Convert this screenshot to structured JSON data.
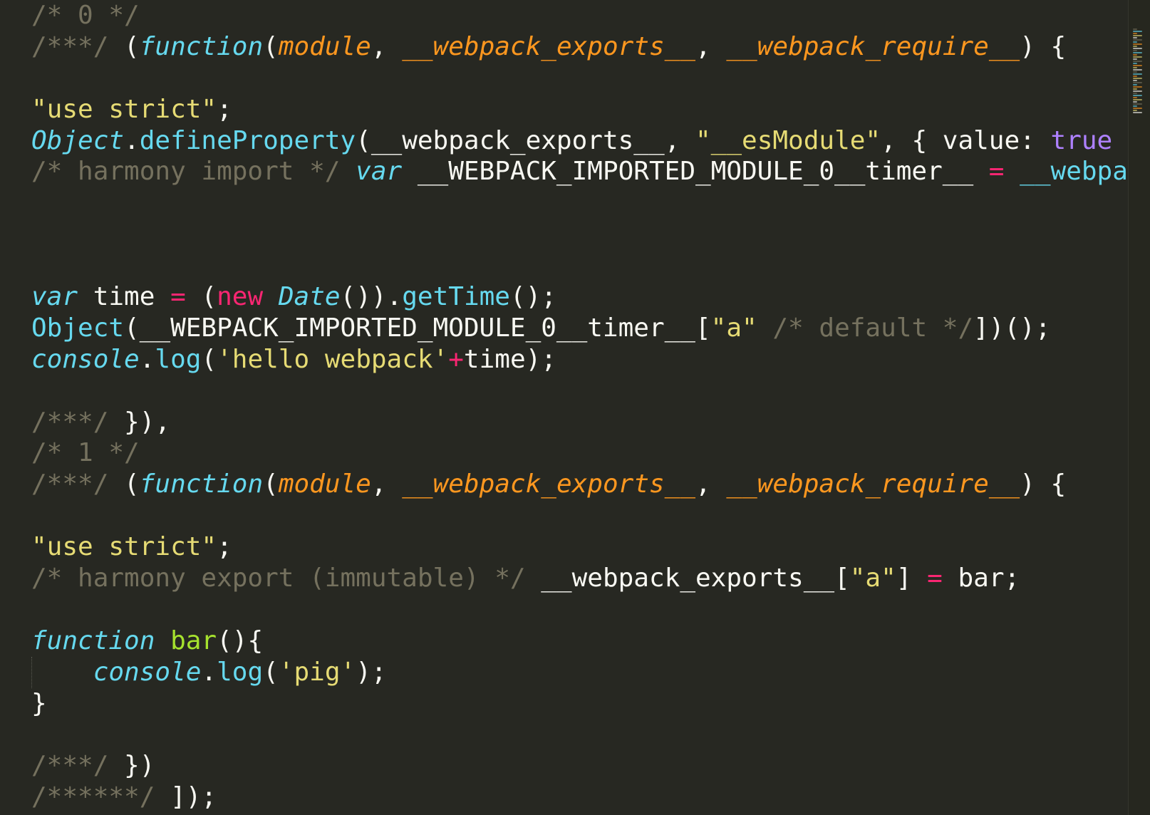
{
  "editor": {
    "theme_colors": {
      "background": "#272822",
      "foreground": "#f8f8f2",
      "comment": "#75715e",
      "string": "#e6db74",
      "keyword": "#66d9ef",
      "storage_pink": "#f92672",
      "parameter": "#fd971f",
      "constant": "#ae81ff",
      "function_name": "#a6e22e"
    },
    "lines": [
      [
        {
          "t": "/* 0 */",
          "c": "comment"
        }
      ],
      [
        {
          "t": "/***/ ",
          "c": "comment"
        },
        {
          "t": "(",
          "c": "plain"
        },
        {
          "t": "function",
          "c": "keyword-italic"
        },
        {
          "t": "(",
          "c": "plain"
        },
        {
          "t": "module",
          "c": "param"
        },
        {
          "t": ", ",
          "c": "plain"
        },
        {
          "t": "__webpack_exports__",
          "c": "param"
        },
        {
          "t": ", ",
          "c": "plain"
        },
        {
          "t": "__webpack_require__",
          "c": "param"
        },
        {
          "t": ") {",
          "c": "plain"
        }
      ],
      [],
      [
        {
          "t": "\"use strict\"",
          "c": "string"
        },
        {
          "t": ";",
          "c": "plain"
        }
      ],
      [
        {
          "t": "Object",
          "c": "keyword-italic"
        },
        {
          "t": ".",
          "c": "plain"
        },
        {
          "t": "defineProperty",
          "c": "keyword"
        },
        {
          "t": "(__webpack_exports__, ",
          "c": "plain"
        },
        {
          "t": "\"__esModule\"",
          "c": "string"
        },
        {
          "t": ", { value: ",
          "c": "plain"
        },
        {
          "t": "true",
          "c": "constant"
        },
        {
          "t": " }",
          "c": "plain"
        }
      ],
      [
        {
          "t": "/* harmony import */ ",
          "c": "comment"
        },
        {
          "t": "var",
          "c": "keyword-italic"
        },
        {
          "t": " __WEBPACK_IMPORTED_MODULE_0__timer__ ",
          "c": "plain"
        },
        {
          "t": "=",
          "c": "pink"
        },
        {
          "t": " ",
          "c": "plain"
        },
        {
          "t": "__webpac",
          "c": "keyword"
        }
      ],
      [],
      [],
      [],
      [
        {
          "t": "var",
          "c": "keyword-italic"
        },
        {
          "t": " time ",
          "c": "plain"
        },
        {
          "t": "=",
          "c": "pink"
        },
        {
          "t": " (",
          "c": "plain"
        },
        {
          "t": "new",
          "c": "pink"
        },
        {
          "t": " ",
          "c": "plain"
        },
        {
          "t": "Date",
          "c": "keyword-italic"
        },
        {
          "t": "()).",
          "c": "plain"
        },
        {
          "t": "getTime",
          "c": "keyword"
        },
        {
          "t": "();",
          "c": "plain"
        }
      ],
      [
        {
          "t": "Object",
          "c": "keyword"
        },
        {
          "t": "(__WEBPACK_IMPORTED_MODULE_0__timer__[",
          "c": "plain"
        },
        {
          "t": "\"a\"",
          "c": "string"
        },
        {
          "t": " ",
          "c": "plain"
        },
        {
          "t": "/* default */",
          "c": "comment"
        },
        {
          "t": "])();",
          "c": "plain"
        }
      ],
      [
        {
          "t": "console",
          "c": "keyword-italic"
        },
        {
          "t": ".",
          "c": "plain"
        },
        {
          "t": "log",
          "c": "keyword"
        },
        {
          "t": "(",
          "c": "plain"
        },
        {
          "t": "'hello webpack'",
          "c": "string"
        },
        {
          "t": "+",
          "c": "pink"
        },
        {
          "t": "time);",
          "c": "plain"
        }
      ],
      [],
      [
        {
          "t": "/***/ ",
          "c": "comment"
        },
        {
          "t": "}),",
          "c": "plain"
        }
      ],
      [
        {
          "t": "/* 1 */",
          "c": "comment"
        }
      ],
      [
        {
          "t": "/***/ ",
          "c": "comment"
        },
        {
          "t": "(",
          "c": "plain"
        },
        {
          "t": "function",
          "c": "keyword-italic"
        },
        {
          "t": "(",
          "c": "plain"
        },
        {
          "t": "module",
          "c": "param"
        },
        {
          "t": ", ",
          "c": "plain"
        },
        {
          "t": "__webpack_exports__",
          "c": "param"
        },
        {
          "t": ", ",
          "c": "plain"
        },
        {
          "t": "__webpack_require__",
          "c": "param"
        },
        {
          "t": ") {",
          "c": "plain"
        }
      ],
      [],
      [
        {
          "t": "\"use strict\"",
          "c": "string"
        },
        {
          "t": ";",
          "c": "plain"
        }
      ],
      [
        {
          "t": "/* harmony export (immutable) */ ",
          "c": "comment"
        },
        {
          "t": "__webpack_exports__[",
          "c": "plain"
        },
        {
          "t": "\"a\"",
          "c": "string"
        },
        {
          "t": "] ",
          "c": "plain"
        },
        {
          "t": "=",
          "c": "pink"
        },
        {
          "t": " bar;",
          "c": "plain"
        }
      ],
      [],
      [
        {
          "t": "function",
          "c": "keyword-italic"
        },
        {
          "t": " ",
          "c": "plain"
        },
        {
          "t": "bar",
          "c": "fname"
        },
        {
          "t": "(){",
          "c": "plain"
        }
      ],
      [
        {
          "t": "    ",
          "c": "plain"
        },
        {
          "t": "console",
          "c": "keyword-italic"
        },
        {
          "t": ".",
          "c": "plain"
        },
        {
          "t": "log",
          "c": "keyword"
        },
        {
          "t": "(",
          "c": "plain"
        },
        {
          "t": "'pig'",
          "c": "string"
        },
        {
          "t": ");",
          "c": "plain"
        }
      ],
      [
        {
          "t": "}",
          "c": "plain"
        }
      ],
      [],
      [
        {
          "t": "/***/ ",
          "c": "comment"
        },
        {
          "t": "})",
          "c": "plain"
        }
      ],
      [
        {
          "t": "/******/ ",
          "c": "comment"
        },
        {
          "t": "]);",
          "c": "plain"
        }
      ]
    ]
  }
}
